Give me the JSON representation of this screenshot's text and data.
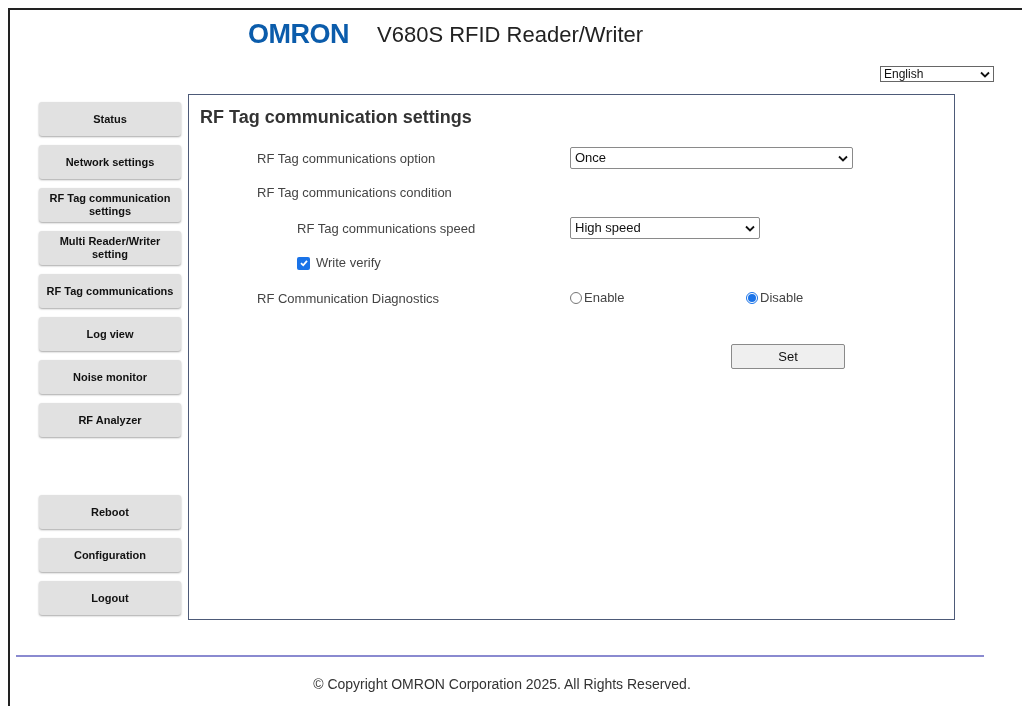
{
  "header": {
    "logo": "OMRON",
    "title": "V680S RFID Reader/Writer",
    "language": {
      "value": "English"
    }
  },
  "sidebar": {
    "items": [
      {
        "label": "Status"
      },
      {
        "label": "Network settings"
      },
      {
        "label": "RF Tag communication settings"
      },
      {
        "label": "Multi Reader/Writer setting"
      },
      {
        "label": "RF Tag communications"
      },
      {
        "label": "Log view"
      },
      {
        "label": "Noise monitor"
      },
      {
        "label": "RF Analyzer"
      }
    ],
    "bottom_items": [
      {
        "label": "Reboot"
      },
      {
        "label": "Configuration"
      },
      {
        "label": "Logout"
      }
    ]
  },
  "panel": {
    "title": "RF Tag communication settings",
    "rows": [
      {
        "kind": "select",
        "label": "RF Tag communications option",
        "value": "Once"
      },
      {
        "kind": "group",
        "label": "RF Tag communications condition",
        "children": [
          {
            "kind": "select",
            "label": "RF Tag communications speed",
            "value": "High speed"
          },
          {
            "kind": "checkbox",
            "label": "Write verify",
            "checked": true
          }
        ]
      },
      {
        "kind": "radio",
        "label": "RF Communication Diagnostics",
        "options": [
          {
            "label": "Enable",
            "selected": false
          },
          {
            "label": "Disable",
            "selected": true
          }
        ]
      }
    ],
    "button": "Set"
  },
  "footer": "© Copyright OMRON Corporation 2025. All Rights Reserved."
}
